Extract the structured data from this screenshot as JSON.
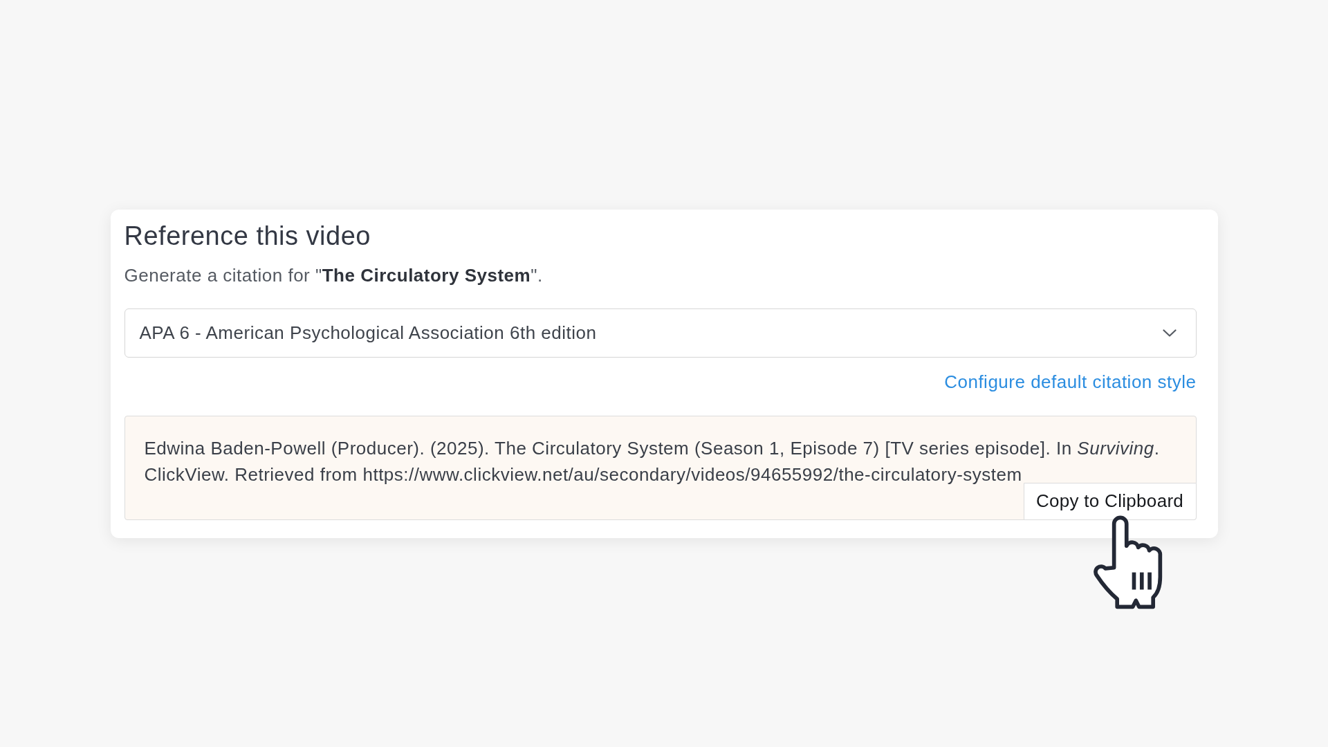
{
  "panel": {
    "title": "Reference this video",
    "subtitle": "Generate a citation for \"**The Circulatory System**\".",
    "citation_style_select": {
      "value": "APA 6 - American Psychological Association 6th edition"
    },
    "configure_link": "Configure default citation style",
    "citation": "Edwina Baden-Powell (Producer). (2025). The Circulatory System (Season 1, Episode 7) [TV series episode]. In *Surviving*. ClickView. Retrieved from https://www.clickview.net/au/secondary/videos/94655992/the-circulatory-system",
    "copy_button": "Copy to Clipboard"
  }
}
